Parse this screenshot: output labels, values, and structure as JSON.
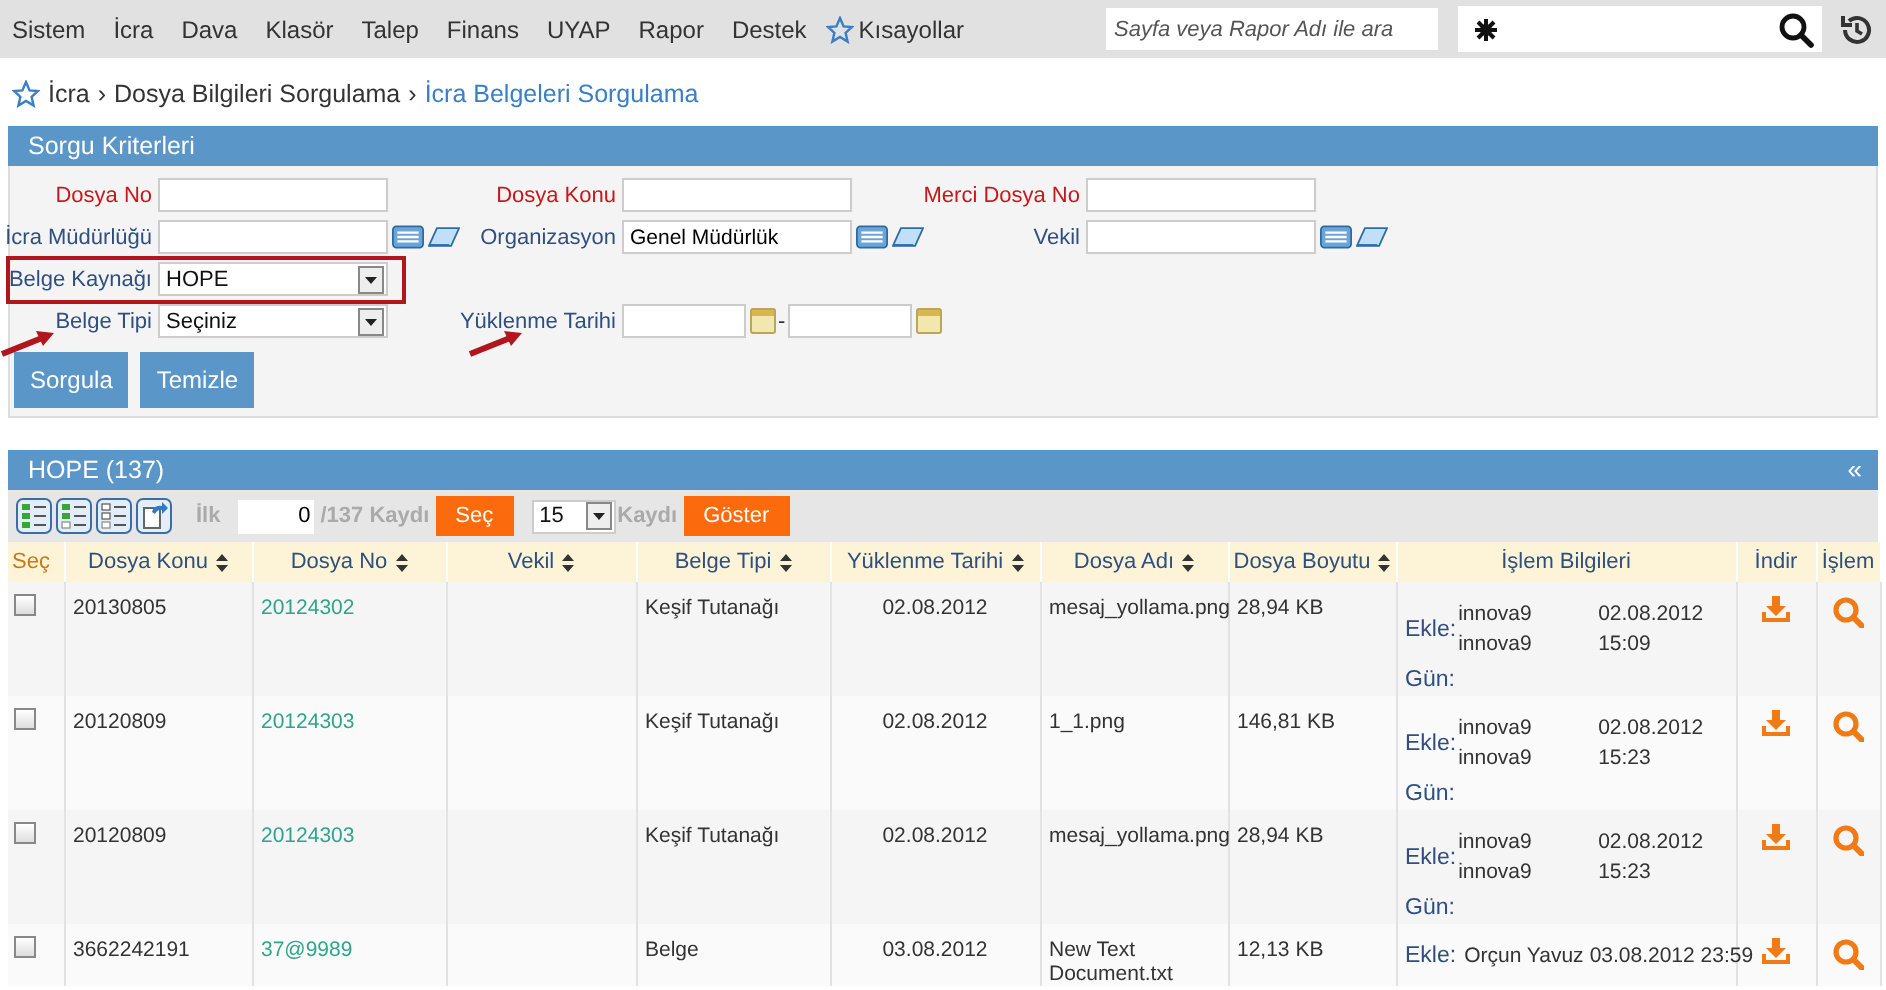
{
  "menu": {
    "items": [
      "Sistem",
      "İcra",
      "Dava",
      "Klasör",
      "Talep",
      "Finans",
      "UYAP",
      "Rapor",
      "Destek"
    ],
    "shortcuts": "Kısayollar",
    "search": {
      "placeholder": "Sayfa veya Rapor Adı ile ara"
    }
  },
  "breadcrumb": {
    "separator": "›",
    "items": [
      "İcra",
      "Dosya Bilgileri Sorgulama",
      "İcra Belgeleri Sorgulama"
    ]
  },
  "criteria": {
    "title": "Sorgu Kriterleri",
    "rows": [
      [
        {
          "label": "Dosya No",
          "kind": "text",
          "required": true
        },
        {
          "label": "Dosya Konu",
          "kind": "text",
          "required": true
        },
        {
          "label": "Merci Dosya No",
          "kind": "text",
          "required": true
        }
      ],
      [
        {
          "label": "İcra Müdürlüğü",
          "kind": "lookup",
          "required": false
        },
        {
          "label": "Organizasyon",
          "kind": "lookup",
          "required": false,
          "value": "Genel Müdürlük"
        },
        {
          "label": "Vekil",
          "kind": "lookup",
          "required": false
        }
      ],
      [
        {
          "label": "Belge Kaynağı",
          "kind": "select",
          "required": false,
          "value": "HOPE",
          "highlighted": true
        }
      ],
      [
        {
          "label": "Belge Tipi",
          "kind": "select",
          "required": false,
          "value": "Seçiniz",
          "arrow": true
        },
        {
          "label": "Yüklenme Tarihi",
          "kind": "daterange",
          "required": false,
          "separator": "-",
          "arrow": true
        }
      ]
    ],
    "buttons": [
      "Sorgula",
      "Temizle"
    ]
  },
  "results": {
    "title": "HOPE (137)",
    "collapse": "«",
    "toolbar": {
      "first_label": "İlk",
      "start": "0",
      "total": "/137 Kaydı",
      "select_button": "Seç",
      "page_size": "15",
      "page_label": "Kaydı",
      "show_button": "Göster"
    },
    "columns": [
      {
        "label": "Seç",
        "sortable": false
      },
      {
        "label": "Dosya Konu",
        "sortable": true
      },
      {
        "label": "Dosya No",
        "sortable": true
      },
      {
        "label": "Vekil",
        "sortable": true
      },
      {
        "label": "Belge Tipi",
        "sortable": true
      },
      {
        "label": "Yüklenme Tarihi",
        "sortable": true
      },
      {
        "label": "Dosya Adı",
        "sortable": true
      },
      {
        "label": "Dosya Boyutu",
        "sortable": true
      },
      {
        "label": "İşlem Bilgileri",
        "sortable": false
      },
      {
        "label": "İndir",
        "sortable": false
      },
      {
        "label": "İşlem",
        "sortable": false
      }
    ],
    "rows": [
      {
        "checked": false,
        "dosya_konu": "20130805",
        "dosya_no": "20124302",
        "belge_tipi": "Keşif Tutanağı",
        "tarih": "02.08.2012",
        "dosya_adi": "mesaj_yollama.png",
        "boyut": "28,94 KB",
        "islem": {
          "kind": "stacked",
          "ekle": "Ekle:",
          "lines": [
            [
              "innova9",
              "02.08.2012"
            ],
            [
              "innova9",
              "15:09"
            ]
          ],
          "gun": "Gün:"
        }
      },
      {
        "checked": false,
        "dosya_konu": "20120809",
        "dosya_no": "20124303",
        "belge_tipi": "Keşif Tutanağı",
        "tarih": "02.08.2012",
        "dosya_adi": "1_1.png",
        "boyut": "146,81 KB",
        "islem": {
          "kind": "stacked",
          "ekle": "Ekle:",
          "lines": [
            [
              "innova9",
              "02.08.2012"
            ],
            [
              "innova9",
              "15:23"
            ]
          ],
          "gun": "Gün:"
        }
      },
      {
        "checked": false,
        "dosya_konu": "20120809",
        "dosya_no": "20124303",
        "belge_tipi": "Keşif Tutanağı",
        "tarih": "02.08.2012",
        "dosya_adi": "mesaj_yollama.png",
        "boyut": "28,94 KB",
        "islem": {
          "kind": "stacked",
          "ekle": "Ekle:",
          "lines": [
            [
              "innova9",
              "02.08.2012"
            ],
            [
              "innova9",
              "15:23"
            ]
          ],
          "gun": "Gün:"
        }
      },
      {
        "checked": false,
        "dosya_konu": "3662242191",
        "dosya_no": "37@9989",
        "belge_tipi": "Belge",
        "tarih": "03.08.2012",
        "dosya_adi": "New Text Document.txt",
        "boyut": "12,13 KB",
        "islem": {
          "kind": "inline",
          "ekle": "Ekle:",
          "lines": [
            [
              "Orçun Yavuz",
              "03.08.2012 23:59"
            ]
          ]
        }
      }
    ]
  }
}
